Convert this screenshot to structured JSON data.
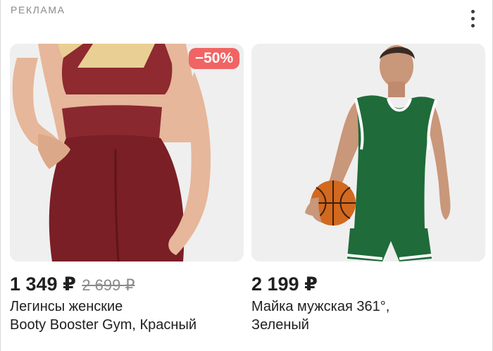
{
  "ad": {
    "label": "РЕКЛАМА",
    "more_icon": "more-vertical-icon"
  },
  "products": [
    {
      "image_alt": "photo-leggings",
      "discount": "−50%",
      "price": "1 349 ₽",
      "old_price": "2 699 ₽",
      "title_line1": "Легинсы женские",
      "title_line2": "Booty Booster Gym, Красный",
      "accent_color": "#7a1f25",
      "badge_color": "#f06464"
    },
    {
      "image_alt": "photo-basketball-jersey",
      "price": "2 199 ₽",
      "title_line1": "Майка мужская 361°,",
      "title_line2": "Зеленый",
      "accent_color": "#1f6b3a"
    }
  ]
}
